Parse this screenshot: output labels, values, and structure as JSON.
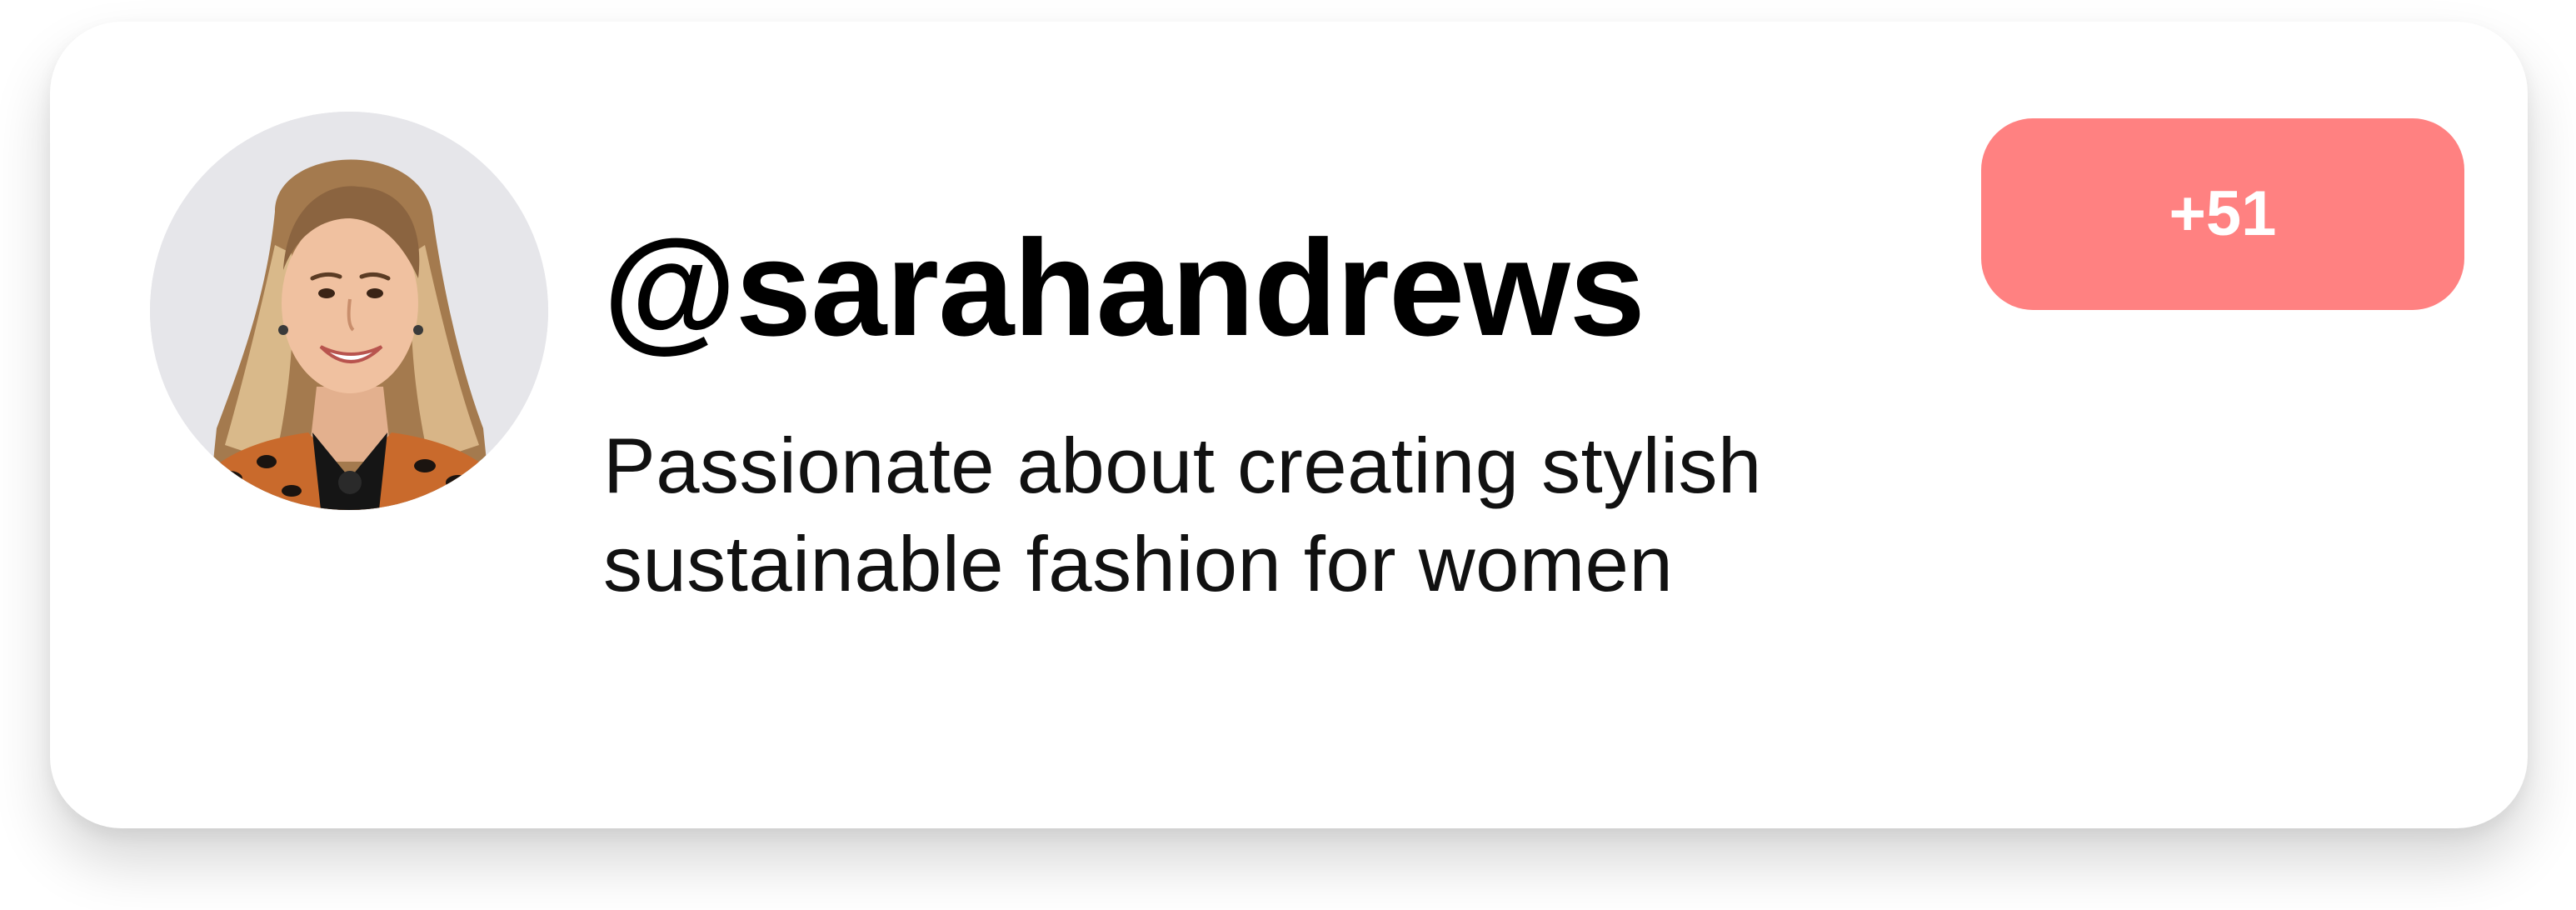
{
  "profile": {
    "username": "@sarahandrews",
    "bio": "Passionate about creating stylish sustainable fashion for women",
    "avatar_icon": "profile-photo"
  },
  "badge": {
    "label": "+51",
    "color": "#ff8181"
  },
  "colors": {
    "card_background": "#ffffff",
    "text_primary": "#000000"
  }
}
